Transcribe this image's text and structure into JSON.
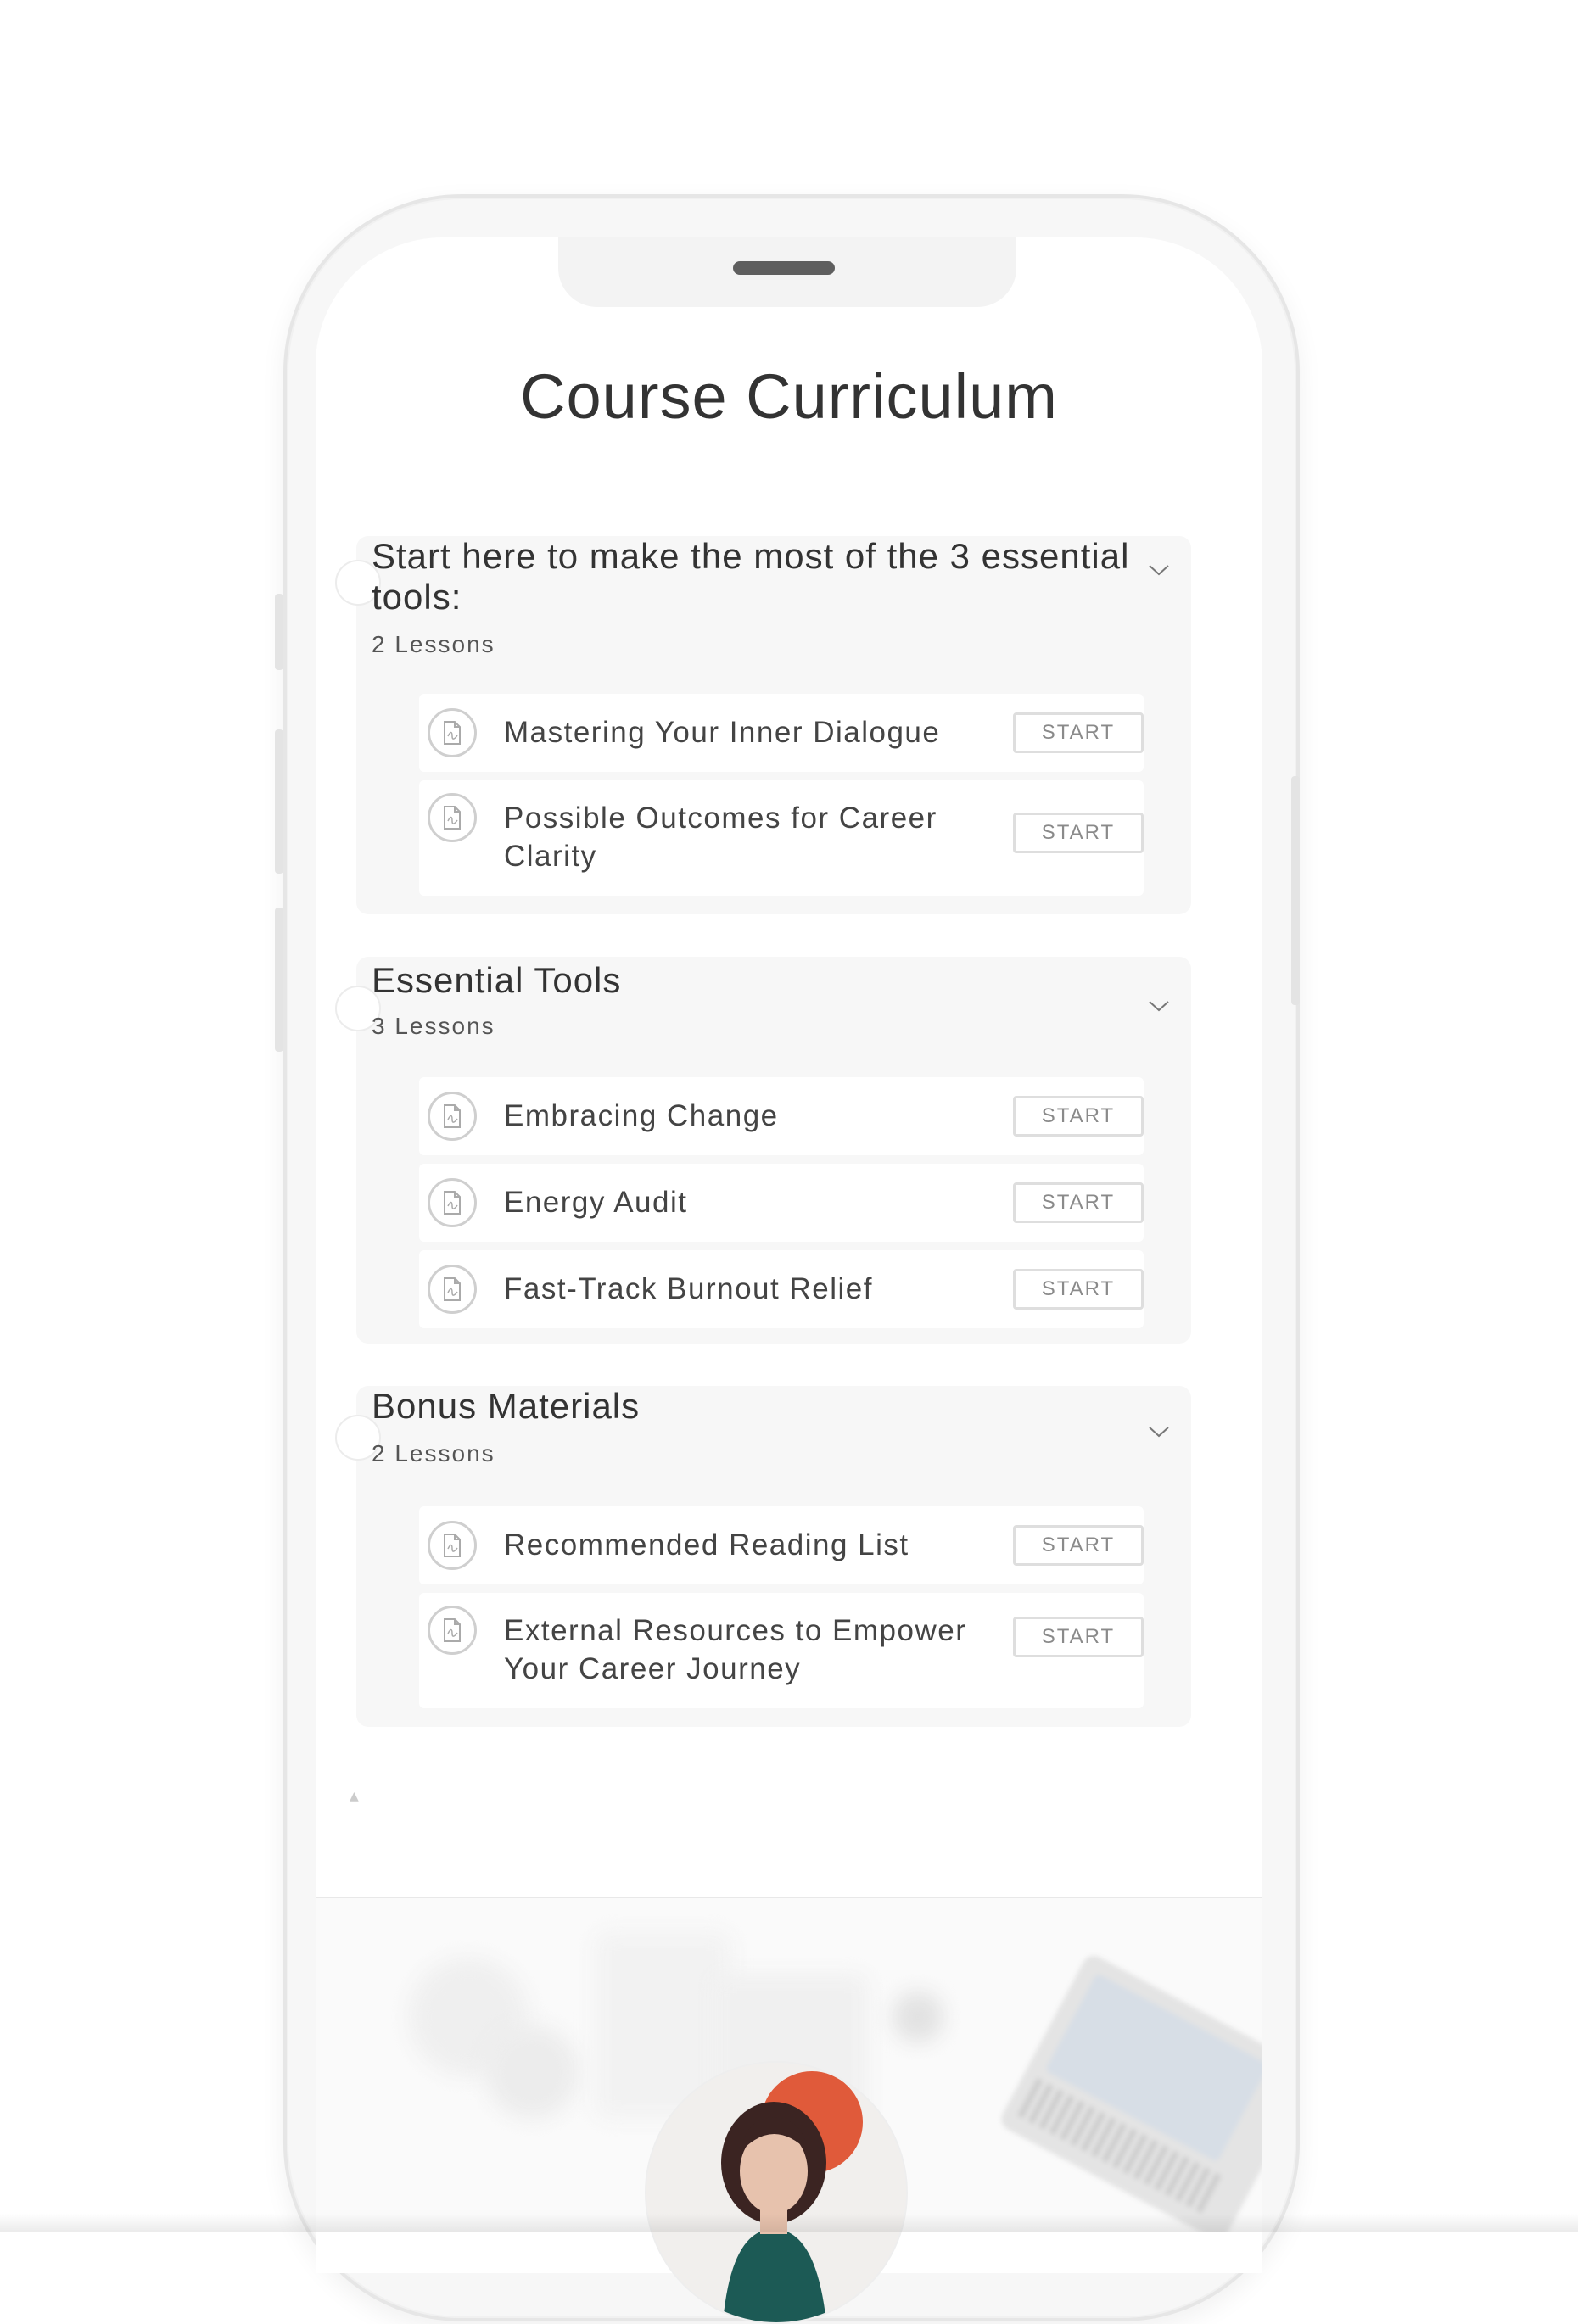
{
  "page": {
    "title": "Course Curriculum"
  },
  "action_label": "START",
  "sections": [
    {
      "title": "Start here to make the most of the 3 essential tools:",
      "meta": "2 Lessons",
      "lessons": [
        {
          "title": "Mastering Your Inner Dialogue"
        },
        {
          "title": "Possible Outcomes for Career Clarity"
        }
      ]
    },
    {
      "title": "Essential Tools",
      "meta": "3 Lessons",
      "lessons": [
        {
          "title": "Embracing Change"
        },
        {
          "title": "Energy Audit"
        },
        {
          "title": "Fast-Track Burnout Relief"
        }
      ]
    },
    {
      "title": "Bonus Materials",
      "meta": "2 Lessons",
      "lessons": [
        {
          "title": "Recommended Reading List"
        },
        {
          "title": "External Resources to Empower Your Career Journey"
        }
      ]
    }
  ],
  "icons": {
    "lesson": "pdf-document-icon",
    "toggle": "chevron-down-icon"
  },
  "colors": {
    "section_bg": "#f7f7f7",
    "button_border": "#dedede",
    "text": "#333333"
  }
}
